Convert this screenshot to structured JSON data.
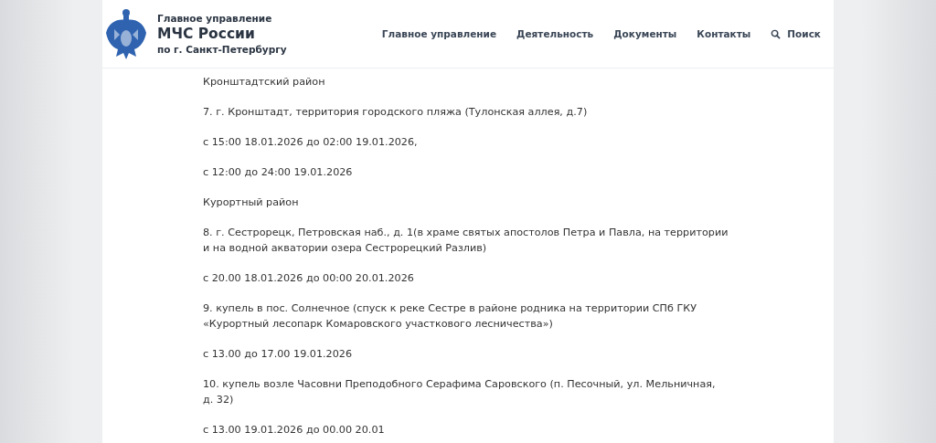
{
  "header": {
    "org_line_1": "Главное управление",
    "org_name": "МЧС России",
    "org_line_2": "по г. Санкт-Петербургу",
    "nav": [
      {
        "label": "Главное управление"
      },
      {
        "label": "Деятельность"
      },
      {
        "label": "Документы"
      },
      {
        "label": "Контакты"
      },
      {
        "label": "Поиск",
        "kind": "search"
      }
    ]
  },
  "paragraphs": [
    "Кронштадтский район",
    "7. г. Кронштадт, территория городского пляжа (Тулонская аллея, д.7)",
    "с 15:00 18.01.2026 до 02:00 19.01.2026,",
    "с 12:00 до 24:00 19.01.2026",
    "Курортный район",
    "8. г. Сестрорецк, Петровская наб., д. 1(в храме святых апостолов Петра и Павла, на территории и на водной акватории озера Сестрорецкий Разлив)",
    "с 20.00 18.01.2026 до 00:00 20.01.2026",
    "9. купель в пос. Солнечное (спуск к реке Сестре в районе родника на территории СПб ГКУ «Курортный лесопарк Комаровского участкового лесничества»)",
    "с 13.00 до 17.00 19.01.2026",
    "10. купель возле Часовни Преподобного Серафима Саровского (п. Песочный, ул. Мельничная, д. 32)",
    "с 13.00 19.01.2026 до 00.00 20.01"
  ]
}
